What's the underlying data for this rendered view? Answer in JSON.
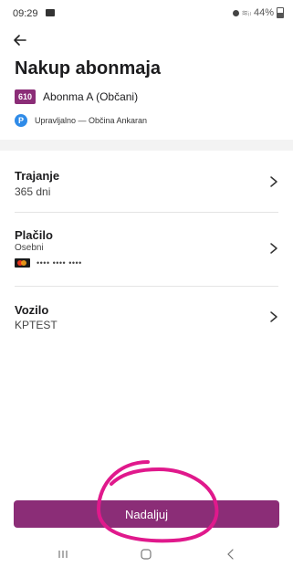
{
  "status_bar": {
    "time": "09:29",
    "battery": "44%"
  },
  "page": {
    "title": "Nakup abonmaja"
  },
  "zone": {
    "code": "610",
    "name": "Abonma A (Občani)"
  },
  "provider": {
    "icon_letter": "P",
    "text": "Upravljalno — Občina Ankaran"
  },
  "sections": {
    "duration": {
      "label": "Trajanje",
      "value": "365 dni"
    },
    "payment": {
      "label": "Plačilo",
      "value": "Osebni",
      "card_mask": "•••• •••• ••••"
    },
    "vehicle": {
      "label": "Vozilo",
      "value": "KPTEST"
    }
  },
  "actions": {
    "continue_label": "Nadaljuj"
  },
  "colors": {
    "brand": "#8b2d77",
    "provider_icon": "#2f8be8",
    "annotation": "#e0198c"
  },
  "icons": {
    "back": "arrow-left-icon",
    "chevron": "chevron-right-icon",
    "nav": [
      "recent-apps-icon",
      "home-icon",
      "back-nav-icon"
    ]
  }
}
